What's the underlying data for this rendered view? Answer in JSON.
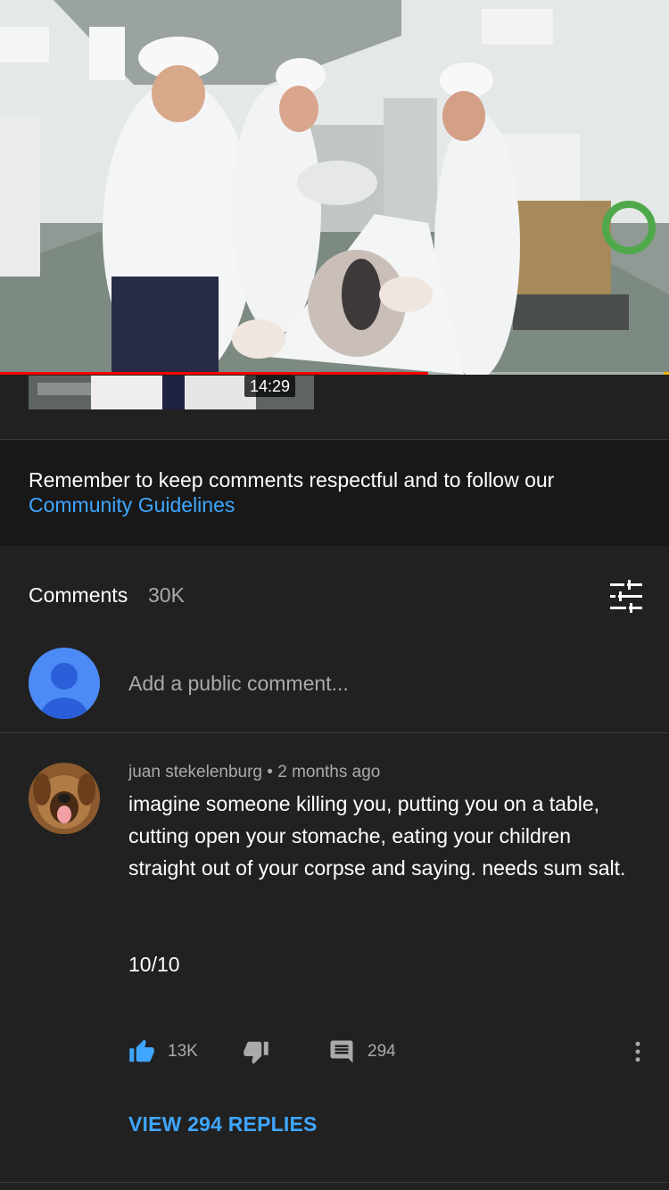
{
  "video": {
    "duration": "14:29",
    "progress": 0.64
  },
  "notice": {
    "text": "Remember to keep comments respectful and to follow our",
    "link": "Community Guidelines"
  },
  "comments": {
    "title": "Comments",
    "count": "30K",
    "sort_icon": "sort-icon"
  },
  "add_comment": {
    "placeholder": "Add a public comment..."
  },
  "comment": {
    "author": "juan stekelenburg",
    "separator": "•",
    "time": "2 months ago",
    "text": "imagine someone killing you, putting you on a table, cutting open your stomache, eating your children straight out of your corpse and saying. needs sum salt.",
    "score": "10/10",
    "likes": "13K",
    "replies_count": "294",
    "view_replies": "VIEW 294 REPLIES"
  },
  "colors": {
    "background": "#212121",
    "notice_background": "#181818",
    "link": "#3ea6ff",
    "progress": "#ff0000",
    "like_active": "#3ea6ff"
  },
  "icons": [
    "thumb-up-icon",
    "thumb-down-icon",
    "reply-icon",
    "more-vert-icon",
    "sort-icon",
    "avatar-placeholder-icon"
  ]
}
